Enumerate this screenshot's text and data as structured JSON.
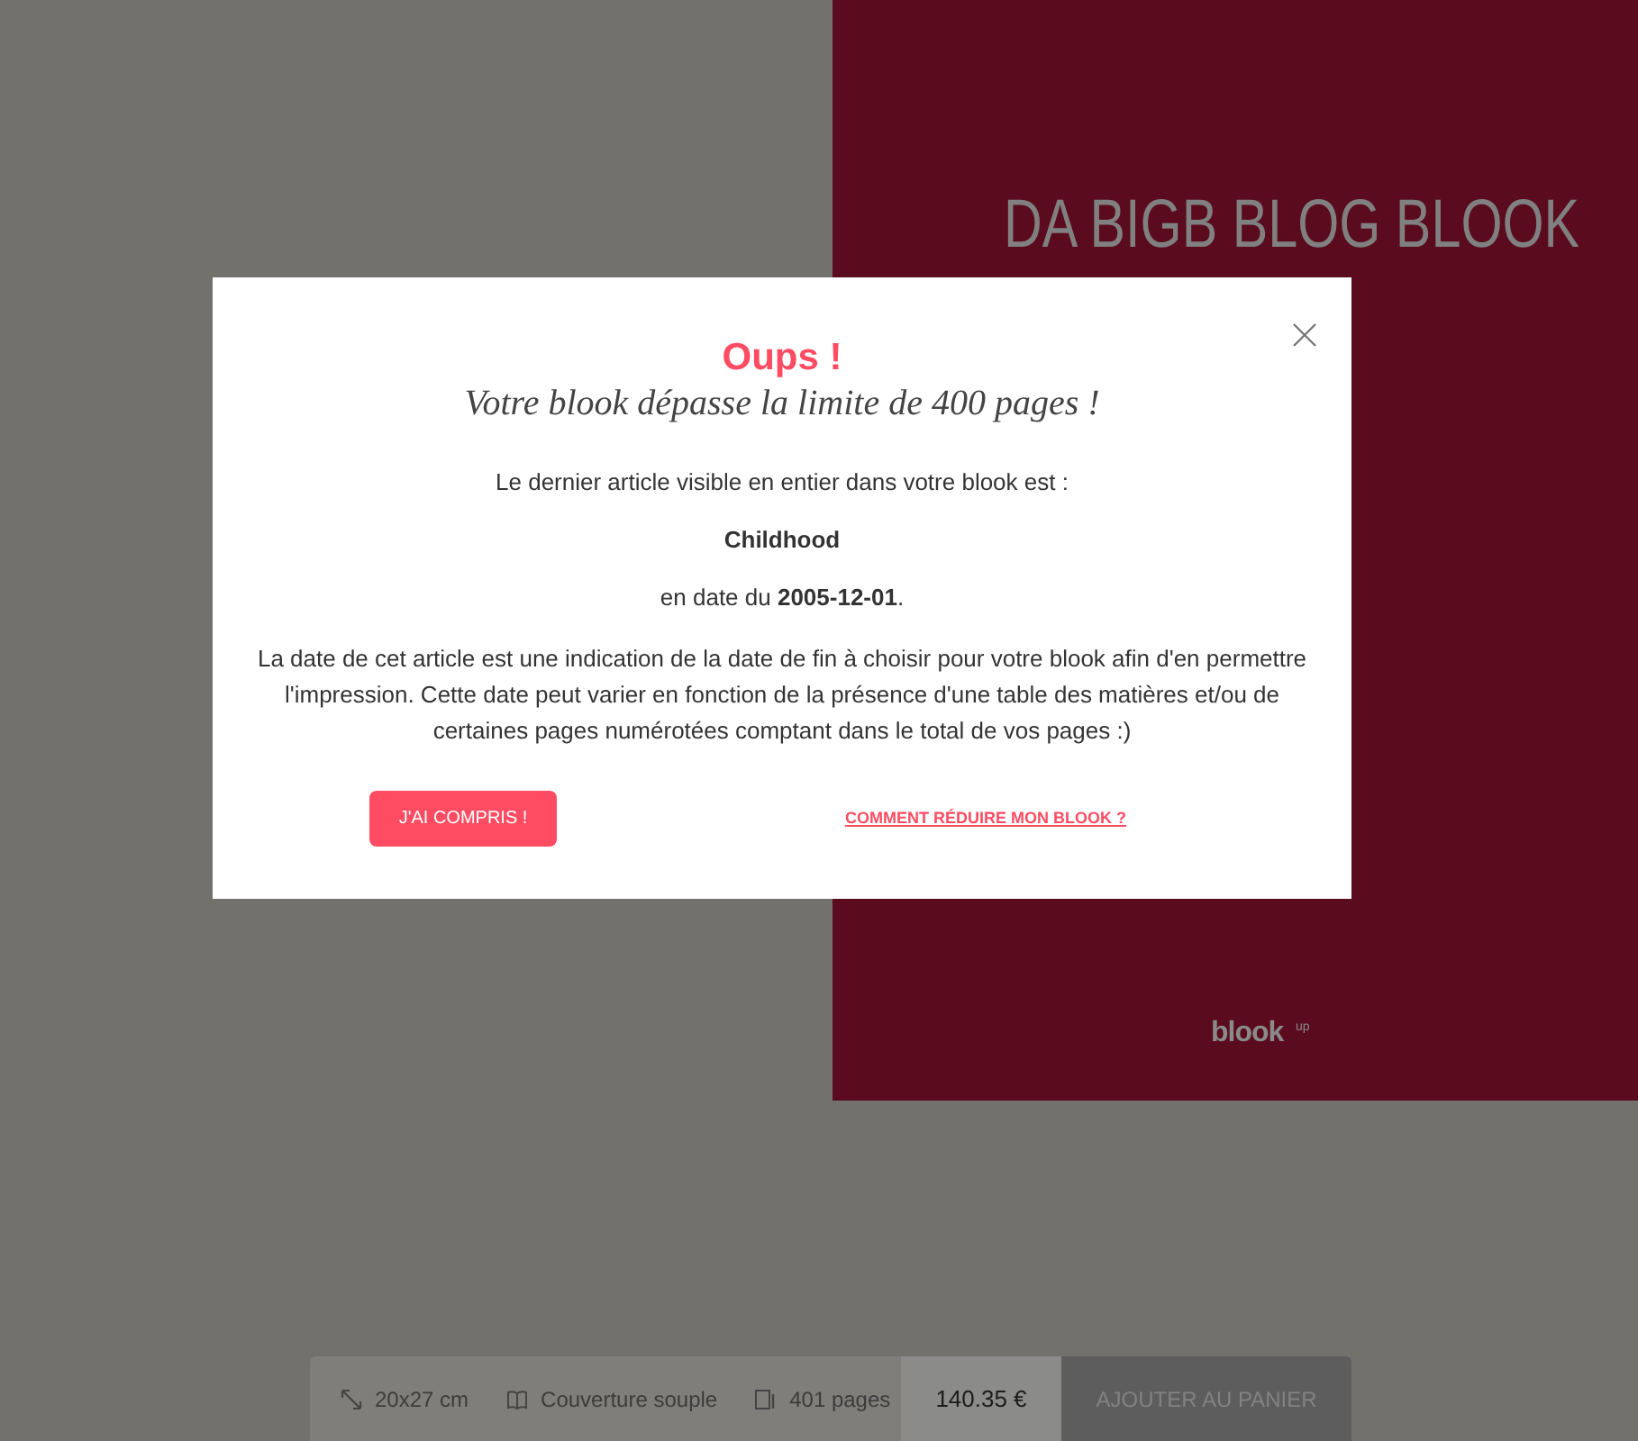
{
  "cover": {
    "title": "DA BIGB BLOG BLOOK",
    "brand": "blook",
    "brand_sup": "up"
  },
  "modal": {
    "title": "Oups !",
    "subtitle": "Votre blook dépasse la limite de 400 pages !",
    "intro": "Le dernier article visible en entier dans votre blook est :",
    "article": "Childhood",
    "date_line": "en date du **2005-12-01**.",
    "note": "La date de cet article est une indication de la date de fin à choisir pour votre blook afin d'en permettre l'impression. Cette date peut varier en fonction de la présence d'une table des matières et/ou de certaines pages numérotées comptant dans le total de vos pages :)",
    "confirm_button": "J'AI COMPRIS !",
    "help_link": "COMMENT RÉDUIRE MON BLOOK ?"
  },
  "product_bar": {
    "specs": [
      {
        "kind": "size",
        "text": "20x27 cm"
      },
      {
        "kind": "cover",
        "text": "Couverture souple"
      },
      {
        "kind": "pages",
        "text": "401 pages"
      }
    ],
    "price": "140.35 €",
    "cart_button": "AJOUTER AU PANIER"
  }
}
